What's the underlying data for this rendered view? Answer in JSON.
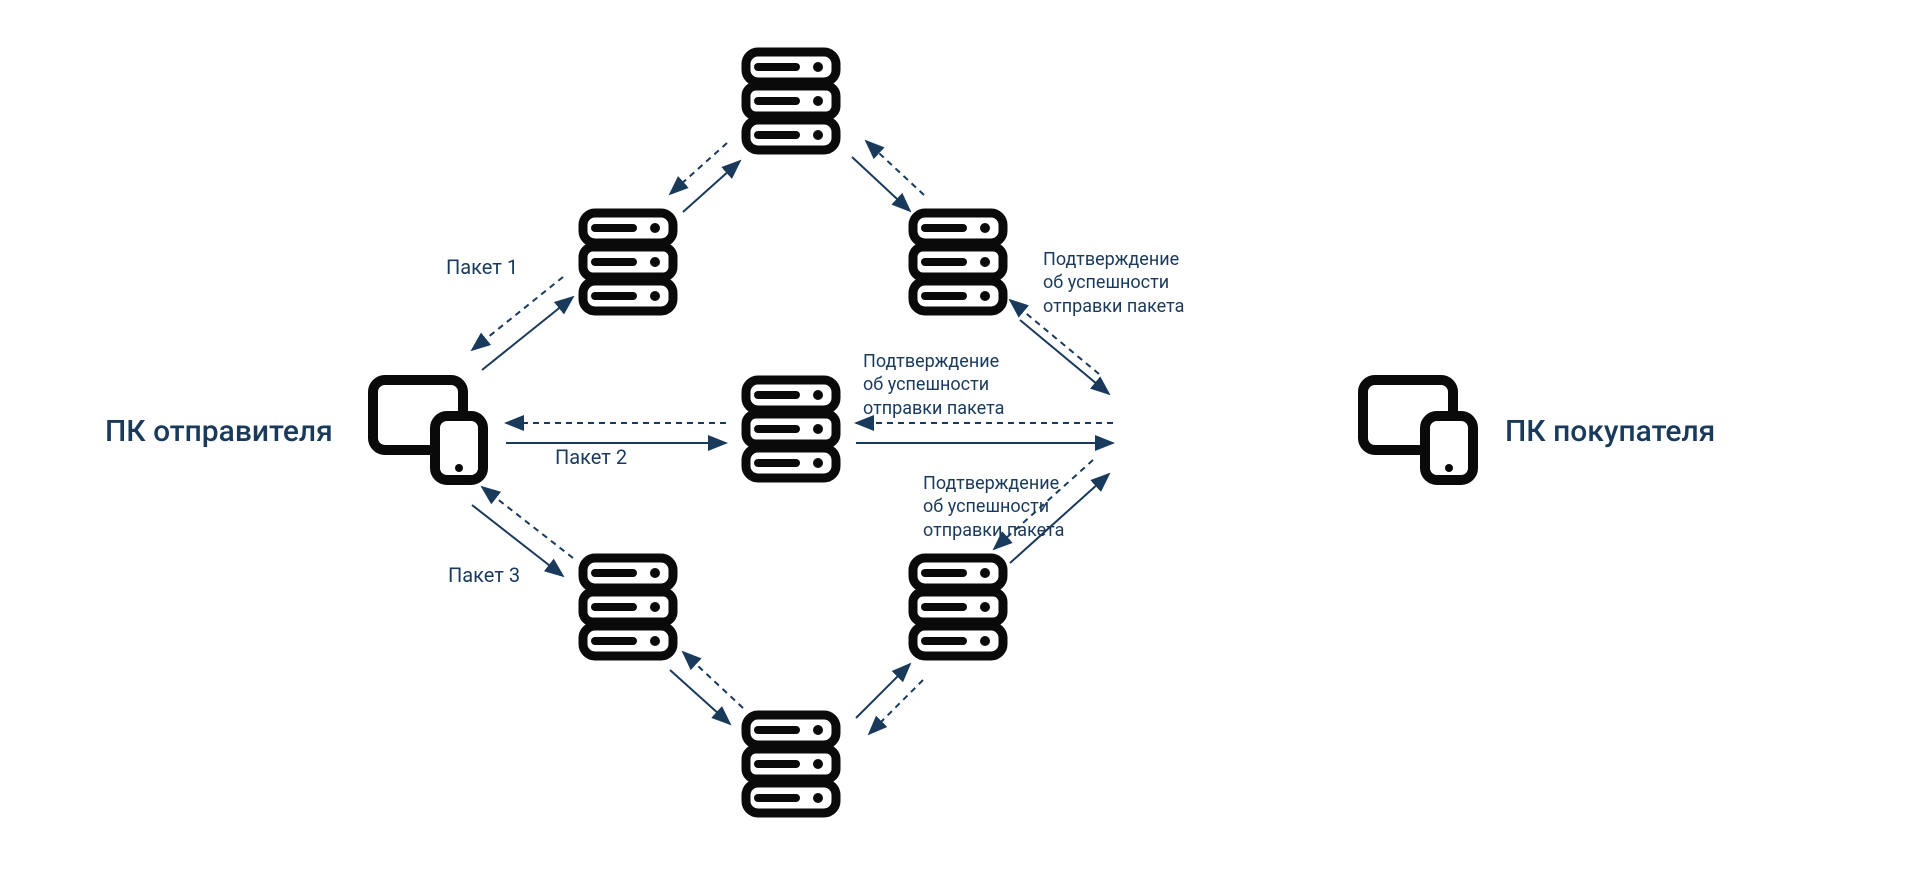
{
  "labels": {
    "sender": "ПК отправителя",
    "buyer": "ПК покупателя",
    "packet1": "Пакет 1",
    "packet2": "Пакет 2",
    "packet3": "Пакет 3",
    "confirm_line1": "Подтверждение",
    "confirm_line2": "об успешности",
    "confirm_line3": "отправки пакета"
  },
  "colors": {
    "stroke": "#1a3a5c",
    "icon": "#0a0a0a"
  }
}
